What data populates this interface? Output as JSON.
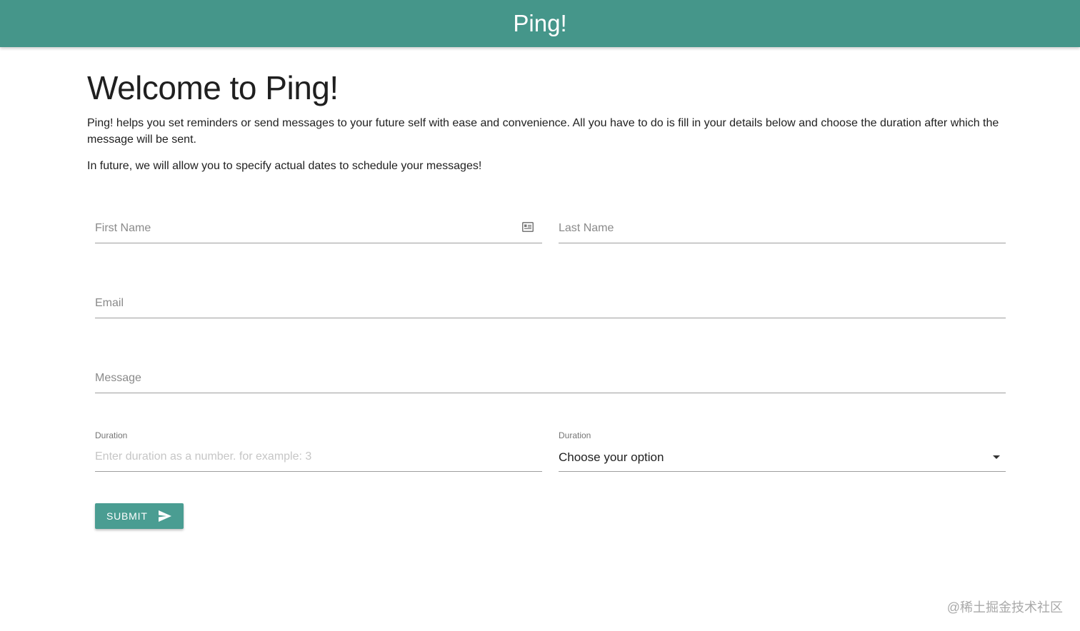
{
  "header": {
    "brand": "Ping!"
  },
  "main": {
    "title": "Welcome to Ping!",
    "intro": "Ping! helps you set reminders or send messages to your future self with ease and convenience. All you have to do is fill in your details below and choose the duration after which the message will be sent.",
    "future_note": "In future, we will allow you to specify actual dates to schedule your messages!"
  },
  "form": {
    "first_name_label": "First Name",
    "last_name_label": "Last Name",
    "email_label": "Email",
    "message_label": "Message",
    "duration_number_label": "Duration",
    "duration_number_placeholder": "Enter duration as a number. for example: 3",
    "duration_unit_label": "Duration",
    "duration_unit_value": "Choose your option",
    "submit_label": "SUBMIT"
  },
  "watermark": "@稀土掘金技术社区",
  "colors": {
    "primary": "#45968a",
    "button": "#4a9d92"
  },
  "icons": {
    "first_name_icon": "contact-card-icon",
    "submit_icon": "send-icon",
    "duration_select_icon": "caret-down-icon"
  }
}
